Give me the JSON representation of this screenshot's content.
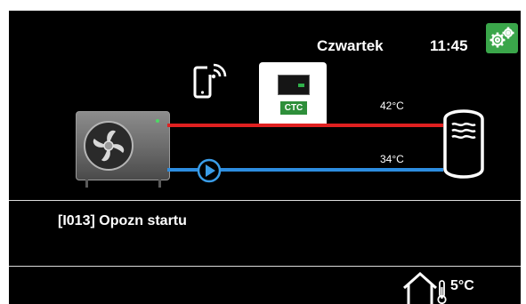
{
  "header": {
    "day": "Czwartek",
    "time": "11:45",
    "settings_icon": "gear-icon"
  },
  "system": {
    "supply_temp": "42°C",
    "return_temp": "34°C",
    "controller_brand": "CTC",
    "icons": [
      "remote-phone-icon",
      "controller-display-icon",
      "heat-pump-unit-icon",
      "circulation-pump-icon",
      "water-tank-icon"
    ]
  },
  "status": {
    "message": "[I013] Opozn startu"
  },
  "footer": {
    "outdoor_temp": "5°C",
    "outdoor_icon": "house-thermometer-icon"
  },
  "colors": {
    "background": "#000000",
    "settings_button": "#3aa64a",
    "supply_pipe": "#e02020",
    "return_pipe": "#2d8de0",
    "pump_icon": "#3a9de8"
  }
}
